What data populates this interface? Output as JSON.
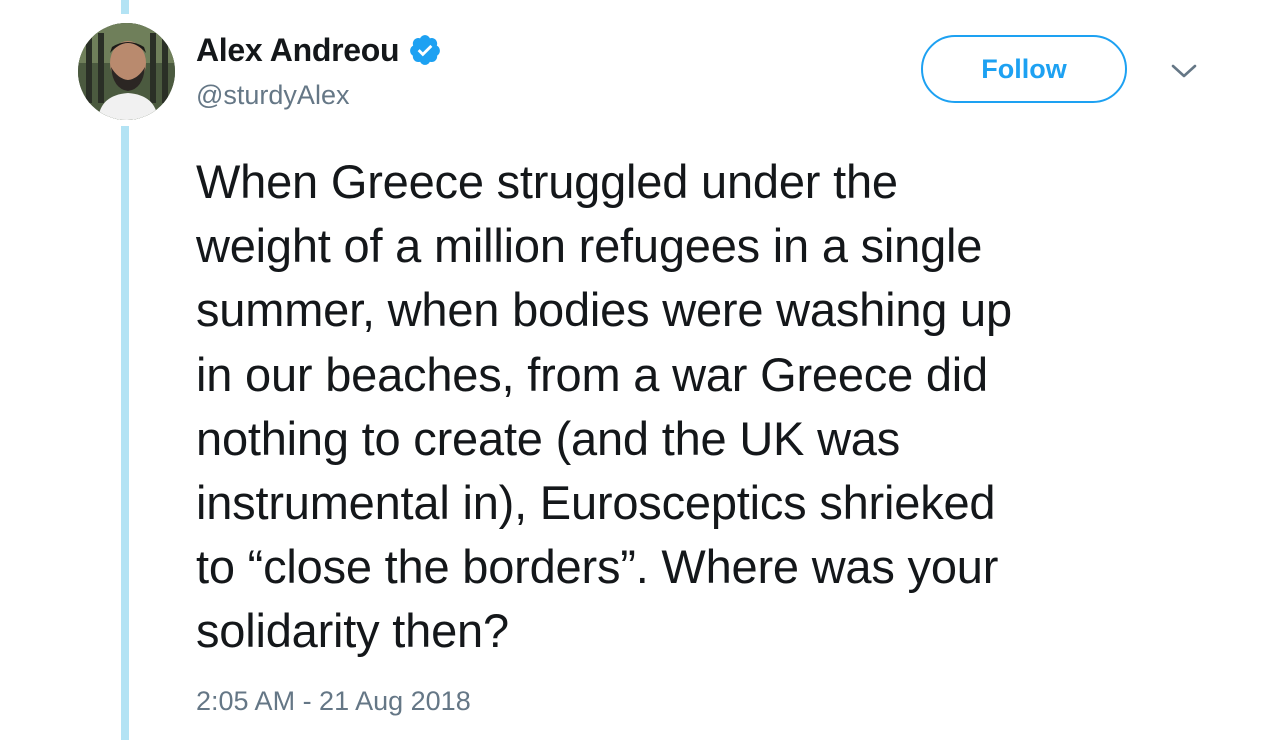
{
  "author": {
    "display_name": "Alex Andreou",
    "handle": "@sturdyAlex",
    "verified_icon": "verified-badge-icon"
  },
  "actions": {
    "follow_label": "Follow",
    "menu_icon": "chevron-down-icon"
  },
  "tweet": {
    "lines": [
      "When Greece struggled under the",
      "weight of a million refugees in a single",
      "summer, when bodies were washing up",
      "in our beaches, from a war Greece did",
      "nothing to create (and the UK was",
      "instrumental in), Eurosceptics shrieked",
      "to “close the borders”. Where was your",
      "solidarity then?"
    ],
    "timestamp": "2:05 AM - 21 Aug 2018"
  },
  "colors": {
    "accent": "#1da1f2",
    "thread_line": "#b3e3f4",
    "secondary_text": "#657786",
    "primary_text": "#14171a"
  }
}
